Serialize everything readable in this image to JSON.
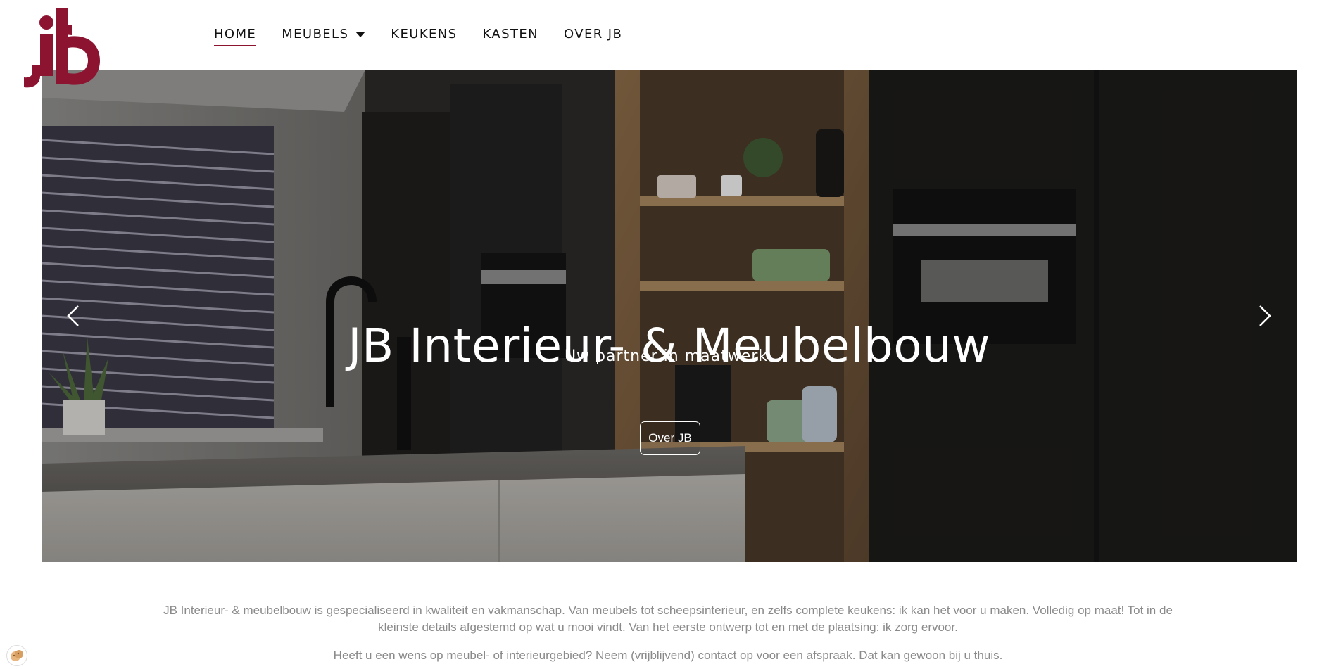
{
  "brand": {
    "logo_icon": "jb-logo-icon",
    "color": "#8d1430"
  },
  "nav": {
    "items": [
      {
        "label": "HOME",
        "active": true
      },
      {
        "label": "MEUBELS",
        "has_dropdown": true
      },
      {
        "label": "KEUKENS"
      },
      {
        "label": "KASTEN"
      },
      {
        "label": "OVER JB"
      }
    ]
  },
  "hero": {
    "title": "JB Interieur- & Meubelbouw",
    "subtitle": "Uw partner in maatwerk.",
    "button_label": "Over JB",
    "prev_icon": "chevron-left-icon",
    "next_icon": "chevron-right-icon"
  },
  "intro": {
    "paragraph1": "JB Interieur- & meubelbouw is gespecialiseerd in kwaliteit en vakmanschap. Van meubels tot scheepsinterieur, en zelfs complete keukens: ik kan het voor u maken. Volledig op maat! Tot in de kleinste details afgestemd op wat u mooi vindt. Van het eerste ontwerp tot en met de plaatsing: ik zorg ervoor.",
    "paragraph2": "Heeft u een wens op meubel- of interieurgebied? Neem (vrijblijvend) contact op voor een afspraak. Dat kan gewoon bij u thuis."
  },
  "cookie": {
    "icon": "cookie-icon"
  }
}
